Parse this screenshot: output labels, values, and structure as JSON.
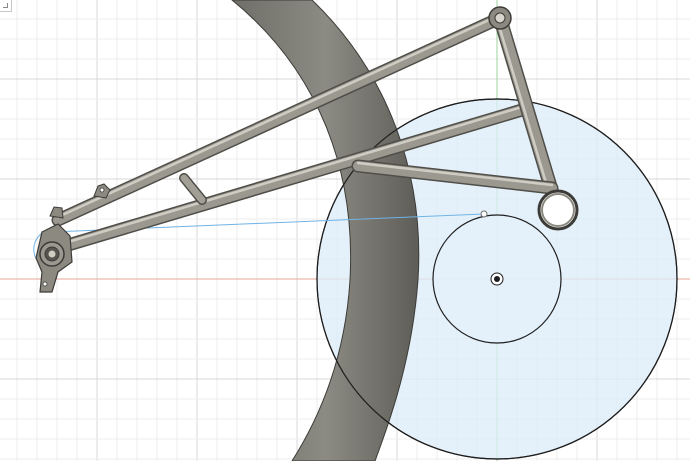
{
  "app": {
    "name": "",
    "view": "cad-sketch-canvas"
  },
  "colors": {
    "background": "#ffffff",
    "grid_minor": "#ececec",
    "grid_major": "#d9d9d9",
    "axis_x": "#e8a59a",
    "axis_y": "#9fd39f",
    "sketch_line": "#6fb3e6",
    "region_fill": "#dcecf8",
    "outline": "#1e1e1e",
    "tube": "#8b8980",
    "tube_highlight": "#c9c7bd",
    "tube_shadow": "#55544e",
    "rim": "#7b7a72"
  },
  "icons": {
    "corner": "view-corner-icon",
    "origin": "origin-point-icon"
  }
}
